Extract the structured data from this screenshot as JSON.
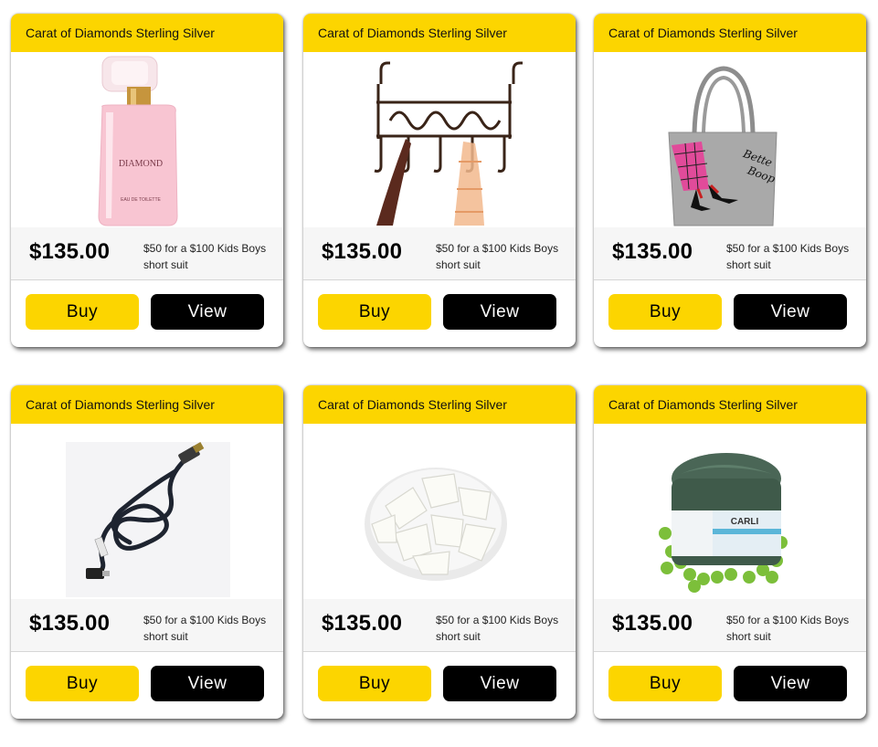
{
  "products": [
    {
      "title": "Carat of Diamonds Sterling Silver",
      "image": "pink-perfume-bottle",
      "price": "$135.00",
      "deal": "$50 for a $100 Kids Boys short suit",
      "buy_label": "Buy",
      "view_label": "View"
    },
    {
      "title": "Carat of Diamonds Sterling Silver",
      "image": "over-door-hook-rack",
      "price": "$135.00",
      "deal": "$50 for a $100 Kids Boys short suit",
      "buy_label": "Buy",
      "view_label": "View"
    },
    {
      "title": "Carat of Diamonds Sterling Silver",
      "image": "gray-tote-bag",
      "price": "$135.00",
      "deal": "$50 for a $100 Kids Boys short suit",
      "buy_label": "Buy",
      "view_label": "View"
    },
    {
      "title": "Carat of Diamonds Sterling Silver",
      "image": "usb-cable",
      "price": "$135.00",
      "deal": "$50 for a $100 Kids Boys short suit",
      "buy_label": "Buy",
      "view_label": "View"
    },
    {
      "title": "Carat of Diamonds Sterling Silver",
      "image": "white-soap-chunks-bowl",
      "price": "$135.00",
      "deal": "$50 for a $100 Kids Boys short suit",
      "buy_label": "Buy",
      "view_label": "View"
    },
    {
      "title": "Carat of Diamonds Sterling Silver",
      "image": "green-clay-mask-jar",
      "price": "$135.00",
      "deal": "$50 for a $100 Kids Boys short suit",
      "buy_label": "Buy",
      "view_label": "View"
    }
  ],
  "image_text": {
    "perfume_brand": "DIAMOND",
    "perfume_small": "EAU DE TOILETTE",
    "bag_text_1": "Bette",
    "bag_text_2": "Boop"
  },
  "colors": {
    "accent_yellow": "#fcd500",
    "view_button": "#000000",
    "price_band": "#f6f6f6"
  }
}
